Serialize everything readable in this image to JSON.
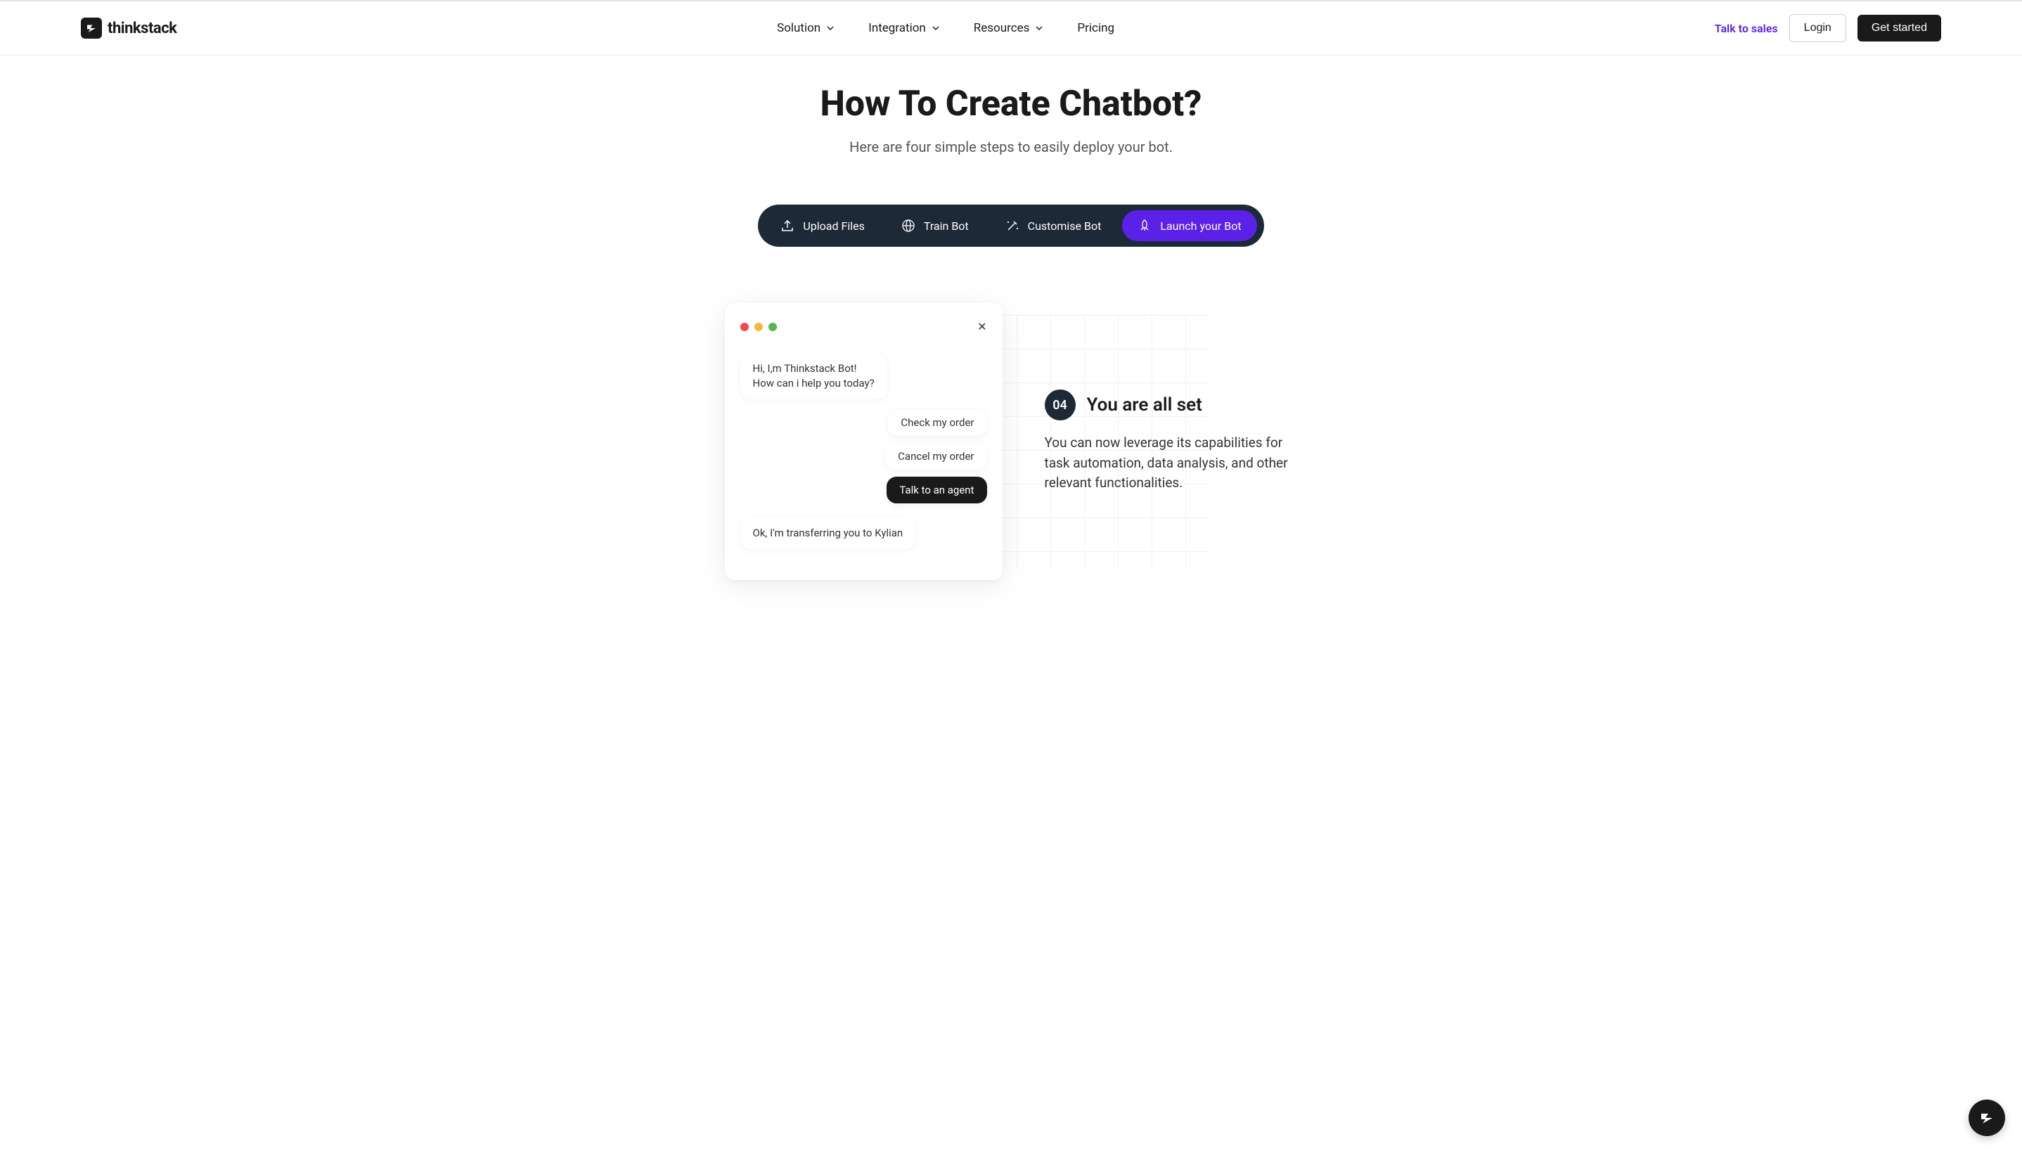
{
  "brand": "thinkstack",
  "nav": {
    "items": [
      {
        "label": "Solution",
        "dropdown": true
      },
      {
        "label": "Integration",
        "dropdown": true
      },
      {
        "label": "Resources",
        "dropdown": true
      },
      {
        "label": "Pricing",
        "dropdown": false
      }
    ]
  },
  "header_actions": {
    "talk_to_sales": "Talk to sales",
    "login": "Login",
    "get_started": "Get started"
  },
  "hero": {
    "title": "How To Create Chatbot?",
    "subtitle": "Here are four simple steps to easily deploy your bot."
  },
  "tabs": [
    {
      "label": "Upload Files",
      "icon": "upload",
      "active": false
    },
    {
      "label": "Train Bot",
      "icon": "globe",
      "active": false
    },
    {
      "label": "Customise Bot",
      "icon": "wand",
      "active": false
    },
    {
      "label": "Launch your Bot",
      "icon": "rocket",
      "active": true
    }
  ],
  "chat": {
    "intro_line1": "Hi, I,m Thinkstack Bot!",
    "intro_line2": "How can i help you today?",
    "options": [
      {
        "label": "Check my order",
        "dark": false
      },
      {
        "label": "Cancel my order",
        "dark": false
      },
      {
        "label": "Talk to an agent",
        "dark": true
      }
    ],
    "reply": "Ok, I'm transferring you to Kylian"
  },
  "step": {
    "number": "04",
    "title": "You are all set",
    "description": "You can now leverage its capabilities for task automation, data analysis, and other relevant functionalities."
  }
}
